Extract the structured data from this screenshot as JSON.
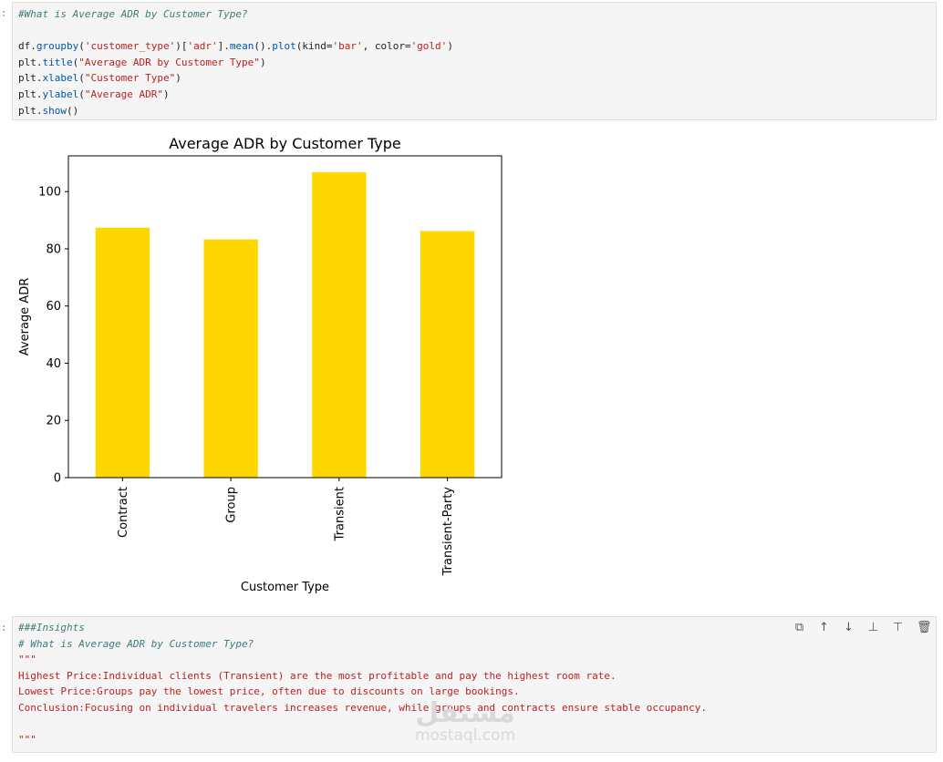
{
  "cells": {
    "code": {
      "prompt": ":",
      "comment": "#What is Average ADR by Customer Type?",
      "line1_a": "df.",
      "line1_fn1": "groupby",
      "line1_b": "(",
      "line1_s1": "'customer_type'",
      "line1_c": ")[",
      "line1_s2": "'adr'",
      "line1_d": "].",
      "line1_fn2": "mean",
      "line1_e": "().",
      "line1_fn3": "plot",
      "line1_f": "(kind=",
      "line1_s3": "'bar'",
      "line1_g": ", color=",
      "line1_s4": "'gold'",
      "line1_h": ")",
      "line2_a": "plt.",
      "line2_fn": "title",
      "line2_b": "(",
      "line2_s": "\"Average ADR by Customer Type\"",
      "line2_c": ")",
      "line3_a": "plt.",
      "line3_fn": "xlabel",
      "line3_b": "(",
      "line3_s": "\"Customer Type\"",
      "line3_c": ")",
      "line4_a": "plt.",
      "line4_fn": "ylabel",
      "line4_b": "(",
      "line4_s": "\"Average ADR\"",
      "line4_c": ")",
      "line5_a": "plt.",
      "line5_fn": "show",
      "line5_b": "()"
    },
    "markdown": {
      "prompt": ":",
      "line1": "###Insights",
      "line2": "# What is Average ADR by Customer Type?",
      "line3": "\"\"\"",
      "line4": "Highest Price:Individual clients (Transient) are the most profitable and pay the highest room rate.",
      "line5": "Lowest Price:Groups pay the lowest price, often due to discounts on large bookings.",
      "line6": "Conclusion:Focusing on individual travelers increases revenue, while groups and contracts ensure stable occupancy.",
      "line7": "",
      "line8": "\"\"\""
    }
  },
  "toolbar": {
    "icons": [
      "copy-icon",
      "arrow-up-icon",
      "arrow-down-icon",
      "insert-above-icon",
      "insert-below-icon",
      "trash-icon"
    ]
  },
  "watermark": {
    "big": "مستقل",
    "small": "mostaql.com"
  },
  "colors": {
    "bar": "#ffd700",
    "comment": "#3d7b7b",
    "string": "#ba2121"
  },
  "chart_data": {
    "type": "bar",
    "title": "Average ADR by Customer Type",
    "xlabel": "Customer Type",
    "ylabel": "Average ADR",
    "categories": [
      "Contract",
      "Group",
      "Transient",
      "Transient-Party"
    ],
    "values": [
      87.4,
      83.3,
      106.8,
      86.2
    ],
    "yticks": [
      0,
      20,
      40,
      60,
      80,
      100
    ],
    "ylim": [
      0,
      112.5
    ],
    "grid": false
  }
}
